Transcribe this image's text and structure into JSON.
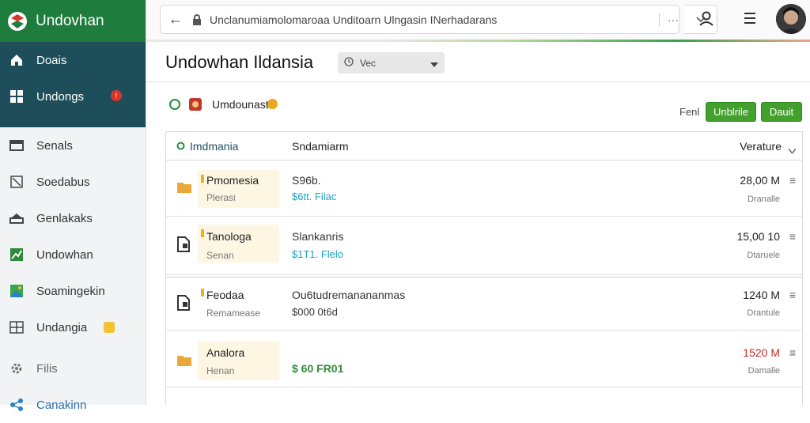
{
  "app": {
    "name": "Undovhan"
  },
  "sidebar": {
    "items": [
      {
        "label": "Doais",
        "icon": "home-icon"
      },
      {
        "label": "Undongs",
        "icon": "grid-icon",
        "badge": "!"
      },
      {
        "label": "Senals",
        "icon": "window-icon"
      },
      {
        "label": "Soedabus",
        "icon": "document-icon"
      },
      {
        "label": "Genlakaks",
        "icon": "drive-icon"
      },
      {
        "label": "Undowhan",
        "icon": "chart-icon"
      },
      {
        "label": "Soamingekin",
        "icon": "photo-icon"
      },
      {
        "label": "Undangia",
        "icon": "table-icon"
      },
      {
        "label": "Filis",
        "icon": "gear-icon"
      },
      {
        "label": "Canakinn",
        "icon": "share-icon"
      }
    ]
  },
  "topbar": {
    "url": "Unclanumiamolomaroaa Unditoarn Ulngasin INerhadarans",
    "more": "···"
  },
  "page": {
    "title": "Undowhan Ildansia",
    "view_select": "Vec"
  },
  "panel": {
    "title": "Umdounast",
    "small_label": "Fenl",
    "btn_primary": "Unblrile",
    "btn_secondary": "Dauit"
  },
  "table": {
    "headers": [
      "Imdmania",
      "Sndamiarm",
      "Verature"
    ],
    "rows": [
      {
        "icon": "folder-icon",
        "name": "Pmomesia",
        "sub": "Plerasi",
        "col_a": "S96b.",
        "col_b": "$6tt. Filac",
        "value": "28,00 M",
        "value_sub": "Dranalle",
        "red": false
      },
      {
        "icon": "file-icon",
        "name": "Tanologa",
        "sub": "Senan",
        "col_a": "Slankanris",
        "col_b": "$1T1. Flelo",
        "value": "15,00 10",
        "value_sub": "Dtaruele",
        "red": false
      },
      {
        "icon": "file-icon",
        "name": "Feodaa",
        "sub": "Remamease",
        "col_a": "Ou6tudremanananmas",
        "col_b": "$000 0t6d",
        "value": "1240 M",
        "value_sub": "Drantule",
        "red": false
      },
      {
        "icon": "folder-icon",
        "name": "Analora",
        "sub": "Henan",
        "col_a": "$ 60 FR01",
        "col_b": "",
        "value": "1520 M",
        "value_sub": "Damalle",
        "red": true
      }
    ]
  },
  "colors": {
    "brand": "#1e7d3c",
    "sidebar_dark": "#1d4e5a",
    "button": "#43a02d",
    "accent_red": "#c62828"
  }
}
